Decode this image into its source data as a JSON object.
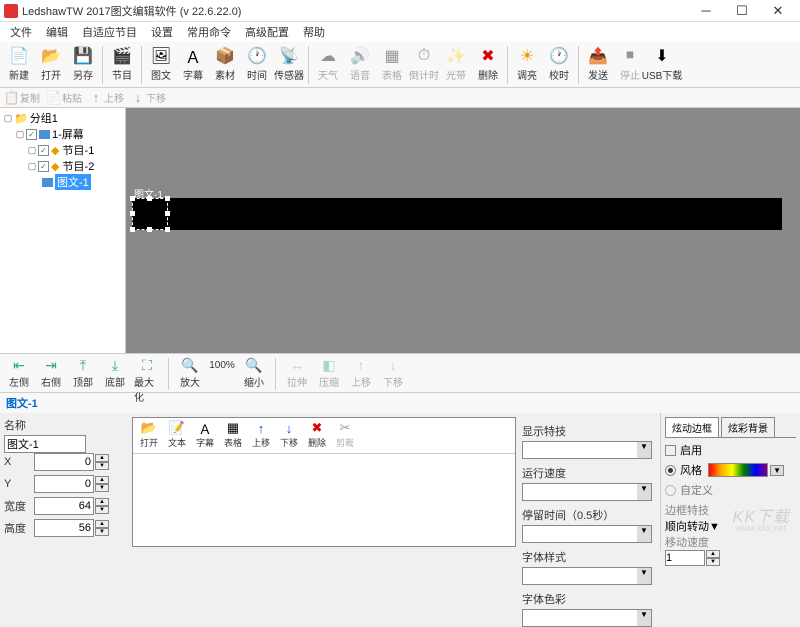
{
  "title": "LedshawTW 2017图文编辑软件 (v 22.6.22.0)",
  "menu": [
    "文件",
    "编辑",
    "自适应节目",
    "设置",
    "常用命令",
    "高级配置",
    "帮助"
  ],
  "toolbar": [
    {
      "icon": "📄",
      "label": "新建",
      "dis": false
    },
    {
      "icon": "📂",
      "label": "打开",
      "dis": false
    },
    {
      "icon": "💾",
      "label": "另存",
      "dis": false
    },
    {
      "sep": true
    },
    {
      "icon": "🎬",
      "label": "节目",
      "dis": false
    },
    {
      "sep": true
    },
    {
      "icon": "🖼",
      "label": "图文",
      "dis": false
    },
    {
      "icon": "Ａ",
      "label": "字幕",
      "dis": false
    },
    {
      "icon": "📦",
      "label": "素材",
      "dis": false
    },
    {
      "icon": "🕐",
      "label": "时间",
      "dis": false
    },
    {
      "icon": "📡",
      "label": "传感器",
      "dis": false
    },
    {
      "sep": true
    },
    {
      "icon": "☁",
      "label": "天气",
      "dis": true
    },
    {
      "icon": "🔊",
      "label": "语音",
      "dis": true
    },
    {
      "icon": "▦",
      "label": "表格",
      "dis": true
    },
    {
      "icon": "⏱",
      "label": "倒计时",
      "dis": true
    },
    {
      "icon": "✨",
      "label": "光带",
      "dis": true
    },
    {
      "icon": "✖",
      "label": "删除",
      "dis": false,
      "color": "#d00"
    },
    {
      "sep": true
    },
    {
      "icon": "☀",
      "label": "调亮",
      "dis": false,
      "color": "#e90"
    },
    {
      "icon": "🕐",
      "label": "校时",
      "dis": false
    },
    {
      "sep": true
    },
    {
      "icon": "📤",
      "label": "发送",
      "dis": false
    },
    {
      "icon": "⏹",
      "label": "停止",
      "dis": true
    },
    {
      "icon": "⬇",
      "label": "USB下载",
      "dis": false
    }
  ],
  "toolbar2": [
    {
      "icon": "📋",
      "label": "复制",
      "dis": true
    },
    {
      "icon": "📄",
      "label": "粘贴",
      "dis": true
    },
    {
      "icon": "↑",
      "label": "上移",
      "dis": true
    },
    {
      "icon": "↓",
      "label": "下移",
      "dis": true
    }
  ],
  "tree": {
    "group": "分组1",
    "screen": "1-屏幕",
    "prog1": "节目-1",
    "prog2": "节目-2",
    "item": "图文-1"
  },
  "canvas_label": "图文-1",
  "midtool": [
    {
      "icon": "⇤",
      "label": "左侧"
    },
    {
      "icon": "⇥",
      "label": "右侧"
    },
    {
      "icon": "⤒",
      "label": "顶部"
    },
    {
      "icon": "⤓",
      "label": "底部"
    },
    {
      "icon": "⛶",
      "label": "最大化"
    },
    {
      "sep": true
    },
    {
      "icon": "🔍",
      "label": "放大"
    },
    {
      "icon": "100%",
      "label": ""
    },
    {
      "icon": "🔍",
      "label": "缩小"
    },
    {
      "sep": true
    },
    {
      "icon": "↔",
      "label": "拉伸",
      "dis": true
    },
    {
      "icon": "◧",
      "label": "压缩",
      "dis": true
    },
    {
      "icon": "↑",
      "label": "上移",
      "dis": true
    },
    {
      "icon": "↓",
      "label": "下移",
      "dis": true
    }
  ],
  "section": "图文-1",
  "props": {
    "name_label": "名称",
    "name_value": "图文-1",
    "x_label": "X",
    "x_value": "0",
    "y_label": "Y",
    "y_value": "0",
    "w_label": "宽度",
    "w_value": "64",
    "h_label": "高度",
    "h_value": "56"
  },
  "editor_toolbar": [
    {
      "icon": "📂",
      "label": "打开"
    },
    {
      "icon": "📝",
      "label": "文本"
    },
    {
      "icon": "Ａ",
      "label": "字幕"
    },
    {
      "icon": "▦",
      "label": "表格"
    },
    {
      "icon": "↑",
      "label": "上移",
      "color": "#05d"
    },
    {
      "icon": "↓",
      "label": "下移",
      "color": "#05d"
    },
    {
      "icon": "✖",
      "label": "删除",
      "color": "#d00"
    },
    {
      "icon": "✂",
      "label": "剪裁",
      "dis": true
    }
  ],
  "rpanel": {
    "display_tech": "显示特技",
    "run_speed": "运行速度",
    "stay_time": "停留时间（0.5秒）",
    "font_style": "字体样式",
    "font_color": "字体色彩"
  },
  "rpanel2": {
    "tab1": "炫动边框",
    "tab2": "炫彩背景",
    "enable": "启用",
    "style": "风格",
    "custom": "自定义",
    "border_tech": "边框特技",
    "border_opt": "顺向转动",
    "move_speed": "移动速度",
    "speed_val": "1"
  },
  "watermark": "KK下载",
  "watermark_url": "www.kkx.net"
}
